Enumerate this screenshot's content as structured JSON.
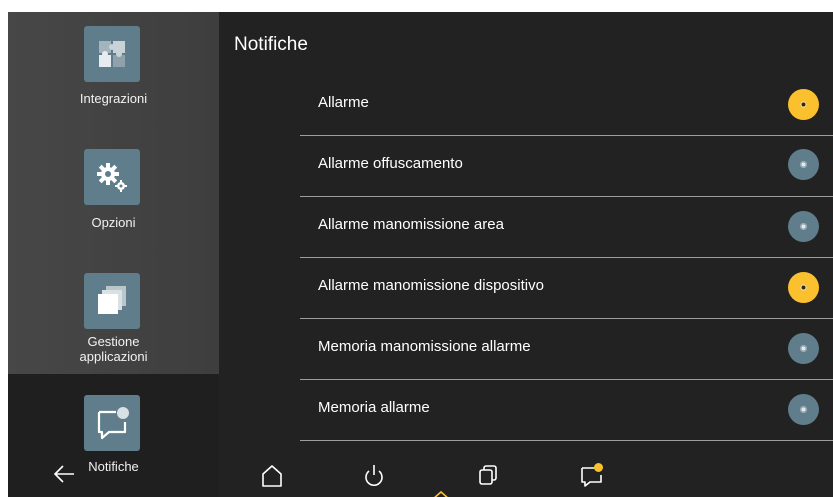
{
  "colors": {
    "accent": "#fbc02d",
    "tile": "#607d8b",
    "off_radio": "#607d8b",
    "background": "#222222"
  },
  "header": {
    "title": "Notifiche"
  },
  "sidebar": {
    "items": [
      {
        "label": "Integrazioni",
        "icon": "puzzle-icon"
      },
      {
        "label": "Opzioni",
        "icon": "gears-icon"
      },
      {
        "label_line1": "Gestione",
        "label_line2": "applicazioni",
        "icon": "stacked-windows-icon"
      },
      {
        "label": "Notifiche",
        "icon": "notification-bubble-icon",
        "active": true
      }
    ],
    "back_icon": "back-arrow-icon"
  },
  "notifications": [
    {
      "label": "Allarme",
      "enabled": true
    },
    {
      "label": "Allarme offuscamento",
      "enabled": false
    },
    {
      "label": "Allarme manomissione area",
      "enabled": false
    },
    {
      "label": "Allarme manomissione dispositivo",
      "enabled": true
    },
    {
      "label": "Memoria manomissione allarme",
      "enabled": false
    },
    {
      "label": "Memoria allarme",
      "enabled": false
    }
  ],
  "bottom_nav": [
    {
      "icon": "home-icon"
    },
    {
      "icon": "power-icon"
    },
    {
      "icon": "apps-icon"
    },
    {
      "icon": "notification-bubble-icon",
      "badge": true
    }
  ]
}
